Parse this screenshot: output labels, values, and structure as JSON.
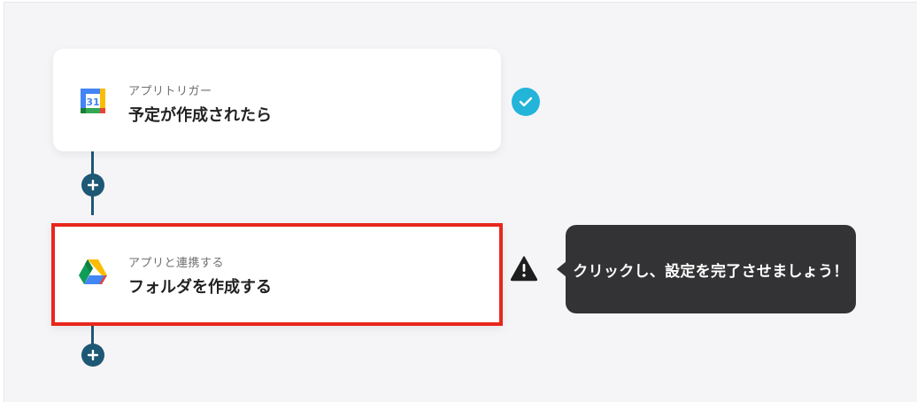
{
  "flow": {
    "steps": [
      {
        "category": "アプリトリガー",
        "title": "予定が作成されたら",
        "app_icon": "google-calendar-icon",
        "calendar_day": "31",
        "status_icon": "check-circle-icon",
        "status_color": "#23b4d9"
      },
      {
        "category": "アプリと連携する",
        "title": "フォルダを作成する",
        "app_icon": "google-drive-icon",
        "status_icon": "warning-icon",
        "highlight_color": "#e8271c"
      }
    ],
    "add_step_icon": "plus-icon",
    "connector_color": "#1d5874"
  },
  "tooltip": {
    "text": "クリックし、設定を完了させましょう！"
  }
}
